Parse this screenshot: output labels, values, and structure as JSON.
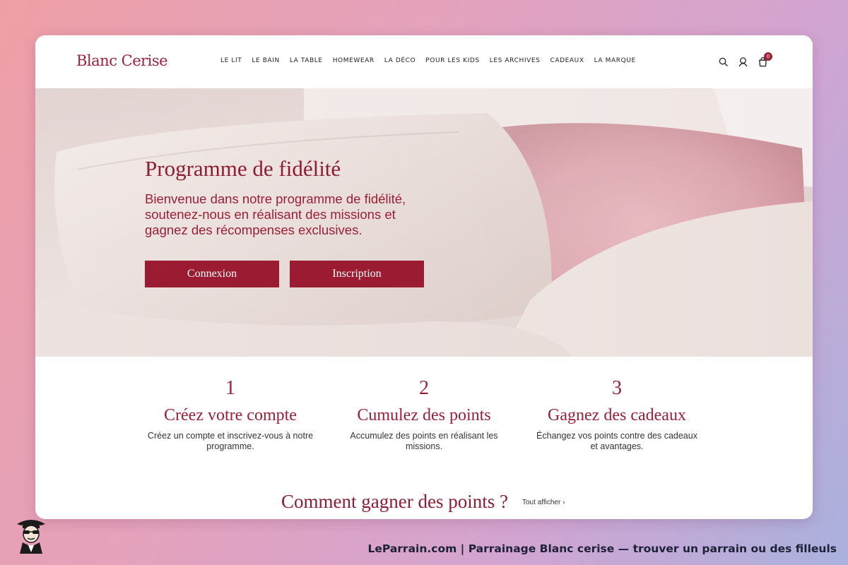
{
  "brand": {
    "logo": "Blanc Cerise",
    "accent": "#9b1b33"
  },
  "nav": {
    "items": [
      {
        "label": "LE LIT"
      },
      {
        "label": "LE BAIN"
      },
      {
        "label": "LA TABLE"
      },
      {
        "label": "HOMEWEAR"
      },
      {
        "label": "LA DÉCO"
      },
      {
        "label": "POUR LES KIDS"
      },
      {
        "label": "LES ARCHIVES"
      },
      {
        "label": "CADEAUX"
      },
      {
        "label": "LA MARQUE"
      }
    ]
  },
  "header_icons": {
    "search": "search-icon",
    "account": "user-icon",
    "cart": "cart-icon",
    "cart_count": "0"
  },
  "hero": {
    "title": "Programme de fidélité",
    "subtitle_lines": [
      "Bienvenue dans notre programme de fidélité,",
      "soutenez-nous en réalisant des missions et",
      "gagnez des récompenses exclusives."
    ],
    "login_label": "Connexion",
    "signup_label": "Inscription"
  },
  "steps": [
    {
      "number": "1",
      "title": "Créez votre compte",
      "desc_lines": [
        "Créez un compte et inscrivez-vous à notre",
        "programme."
      ]
    },
    {
      "number": "2",
      "title": "Cumulez des points",
      "desc_lines": [
        "Accumulez des points en réalisant les",
        "missions."
      ]
    },
    {
      "number": "3",
      "title": "Gagnez des cadeaux",
      "desc_lines": [
        "Échangez vos points contre des cadeaux",
        "et avantages."
      ]
    }
  ],
  "points_section": {
    "title": "Comment gagner des points ?",
    "see_all": "Tout afficher ›"
  },
  "footer_caption": "LeParrain.com | Parrainage Blanc cerise — trouver un parrain ou des filleuls"
}
